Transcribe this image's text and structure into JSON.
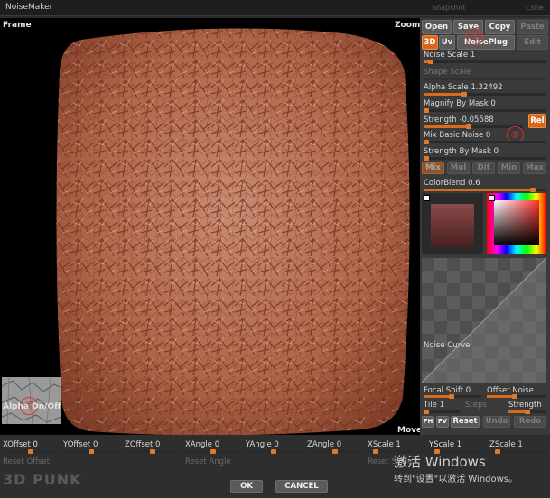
{
  "window": {
    "title": "NoiseMaker",
    "ghost_left": "Snapshot",
    "ghost_right": "Cshe"
  },
  "viewport": {
    "frame_label": "Frame",
    "zoom_label": "Zoom",
    "alpha_label": "Alpha On/Off",
    "move_label": "Move",
    "annotation_1": "①"
  },
  "panel": {
    "buttons_row1": [
      "Open",
      "Save",
      "Copy",
      "Paste"
    ],
    "buttons_row2": [
      "3D",
      "Uv",
      "NoisePlug",
      "Edit"
    ],
    "annotation_3": "③",
    "annotation_2": "②",
    "noise_scale_label": "Noise Scale 1",
    "shape_scale_label": "Shape Scale",
    "alpha_scale_label": "Alpha Scale 1.32492",
    "magnify_label": "Magnify By Mask 0",
    "strength_label": "Strength -0.05588",
    "rel_label": "Rel",
    "mix_label": "Mix Basic Noise 0",
    "strength_mask_label": "Strength By Mask 0",
    "blend_modes": [
      "Mix",
      "Mul",
      "Dif",
      "Min",
      "Max"
    ],
    "colorblend_label": "ColorBlend 0.6",
    "noise_curve_label": "Noise Curve",
    "focal_shift_label": "Focal Shift 0",
    "offset_noise_label": "Offset Noise",
    "tile_label": "Tile 1",
    "steps_label": "Steps",
    "strength2_label": "Strength",
    "curve_buttons": [
      "FH",
      "FV",
      "Reset",
      "Undo",
      "Redo"
    ]
  },
  "bottom": {
    "row1": [
      "XOffset 0",
      "YOffset 0",
      "ZOffset 0",
      "XAngle 0",
      "YAngle 0",
      "ZAngle 0",
      "XScale 1",
      "YScale 1",
      "ZScale 1"
    ],
    "row2": [
      "Reset Offset",
      "Reset Angle",
      "Reset Scale"
    ],
    "ok_label": "OK",
    "cancel_label": "CANCEL",
    "logo_text": "3D PUNK",
    "watermark_1": "激活 Windows",
    "watermark_2": "转到\"设置\"以激活 Windows。"
  },
  "colors": {
    "accent": "#d8661c",
    "panel": "#3a3a3a",
    "viewport": "#000000",
    "leather": "#b56a4c"
  }
}
